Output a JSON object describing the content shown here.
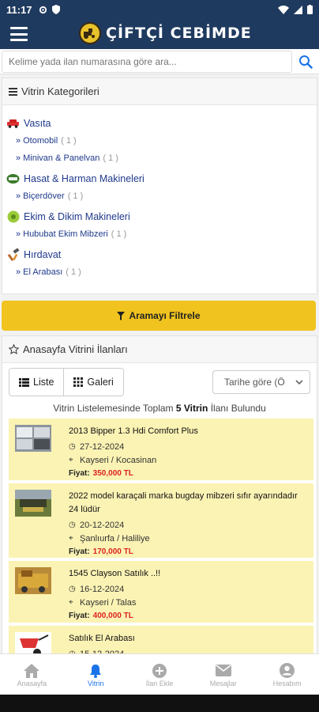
{
  "status": {
    "time": "11:17"
  },
  "app": {
    "logo_text": "ÇİFTÇİ CEBİMDE"
  },
  "search": {
    "placeholder": "Kelime yada ilan numarasına göre ara..."
  },
  "categories": {
    "heading": "Vitrin Kategorileri",
    "groups": [
      {
        "icon": "car-icon",
        "title": "Vasıta",
        "items": [
          {
            "label": "Otomobil",
            "count": "( 1 )"
          },
          {
            "label": "Minivan & Panelvan",
            "count": "( 1 )"
          }
        ]
      },
      {
        "icon": "harvester-icon",
        "title": "Hasat & Harman Makineleri",
        "items": [
          {
            "label": "Biçerdöver",
            "count": "( 1 )"
          }
        ]
      },
      {
        "icon": "seeder-icon",
        "title": "Ekim & Dikim Makineleri",
        "items": [
          {
            "label": "Hububat Ekim Mibzeri",
            "count": "( 1 )"
          }
        ]
      },
      {
        "icon": "tools-icon",
        "title": "Hırdavat",
        "items": [
          {
            "label": "El Arabası",
            "count": "( 1 )"
          }
        ]
      }
    ]
  },
  "filter": {
    "label": "Aramayı Filtrele"
  },
  "showcase": {
    "heading": "Anasayfa Vitrini İlanları",
    "view_list": "Liste",
    "view_gallery": "Galeri",
    "sort": "Tarihe göre (Ö",
    "summary_pre": "Vitrin Listelemesinde Toplam",
    "summary_count": "5 Vitrin",
    "summary_post": "İlanı Bulundu",
    "price_label": "Fiyat:",
    "listings": [
      {
        "title": "2013 Bipper 1.3 Hdi Comfort Plus",
        "date": "27-12-2024",
        "location": "Kayseri / Kocasinan",
        "price": "350,000 TL"
      },
      {
        "title": "2022 model karaçali marka bugday mibzeri sıfır ayarındadır 24 lüdür",
        "date": "20-12-2024",
        "location": "Şanlıurfa / Haliliye",
        "price": "170,000 TL"
      },
      {
        "title": "1545 Clayson Satılık ..!!",
        "date": "16-12-2024",
        "location": "Kayseri / Talas",
        "price": "400,000 TL"
      },
      {
        "title": "Satılık El Arabası",
        "date": "15-12-2024",
        "location": "",
        "price": ""
      }
    ]
  },
  "nav": [
    {
      "label": "Anasayfa",
      "icon": "home-icon"
    },
    {
      "label": "Vitrin",
      "icon": "bell-icon"
    },
    {
      "label": "İlan Ekle",
      "icon": "plus-icon"
    },
    {
      "label": "Mesajlar",
      "icon": "mail-icon"
    },
    {
      "label": "Hesabım",
      "icon": "user-icon"
    }
  ],
  "colors": {
    "primary": "#1f3a5f",
    "accent": "#f0c31e",
    "listing_bg": "#fbf3b4",
    "price": "#dd2222",
    "link": "#1f3a8c",
    "nav_active": "#1a73e8"
  }
}
